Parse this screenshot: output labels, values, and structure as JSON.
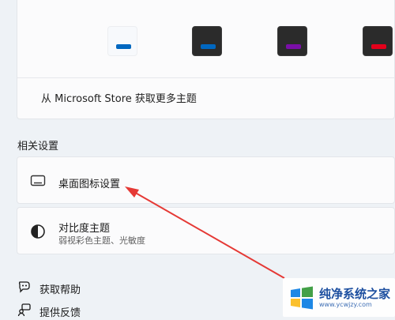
{
  "colors": {
    "accent": "#0f6cbd",
    "swatch_blue_bar": "#0067c0",
    "swatch_purple_bar": "#7a0fa8",
    "swatch_red_bar": "#e3001b",
    "arrow": "#e53935",
    "watermark_text": "#1d4fa0"
  },
  "themes": [
    {
      "name": "light-blue",
      "background": "light",
      "bar_color": "#0067c0"
    },
    {
      "name": "dark-blue",
      "background": "dark",
      "bar_color": "#0067c0"
    },
    {
      "name": "dark-purple",
      "background": "dark",
      "bar_color": "#7a0fa8"
    },
    {
      "name": "dark-red",
      "background": "dark",
      "bar_color": "#e3001b"
    }
  ],
  "themes_panel": {
    "store_link": "从 Microsoft Store 获取更多主题"
  },
  "related_settings": {
    "heading": "相关设置",
    "desktop_icons": {
      "title": "桌面图标设置",
      "icon": "monitor-icon"
    },
    "contrast": {
      "title": "对比度主题",
      "subtitle": "弱视彩色主题、光敏度",
      "icon": "contrast-icon"
    }
  },
  "footer": {
    "help": {
      "label": "获取帮助",
      "icon": "help-chat-icon"
    },
    "feedback": {
      "label": "提供反馈",
      "icon": "feedback-icon"
    }
  },
  "watermark": {
    "title": "纯净系统之家",
    "url": "www.ycwjzy.com"
  }
}
